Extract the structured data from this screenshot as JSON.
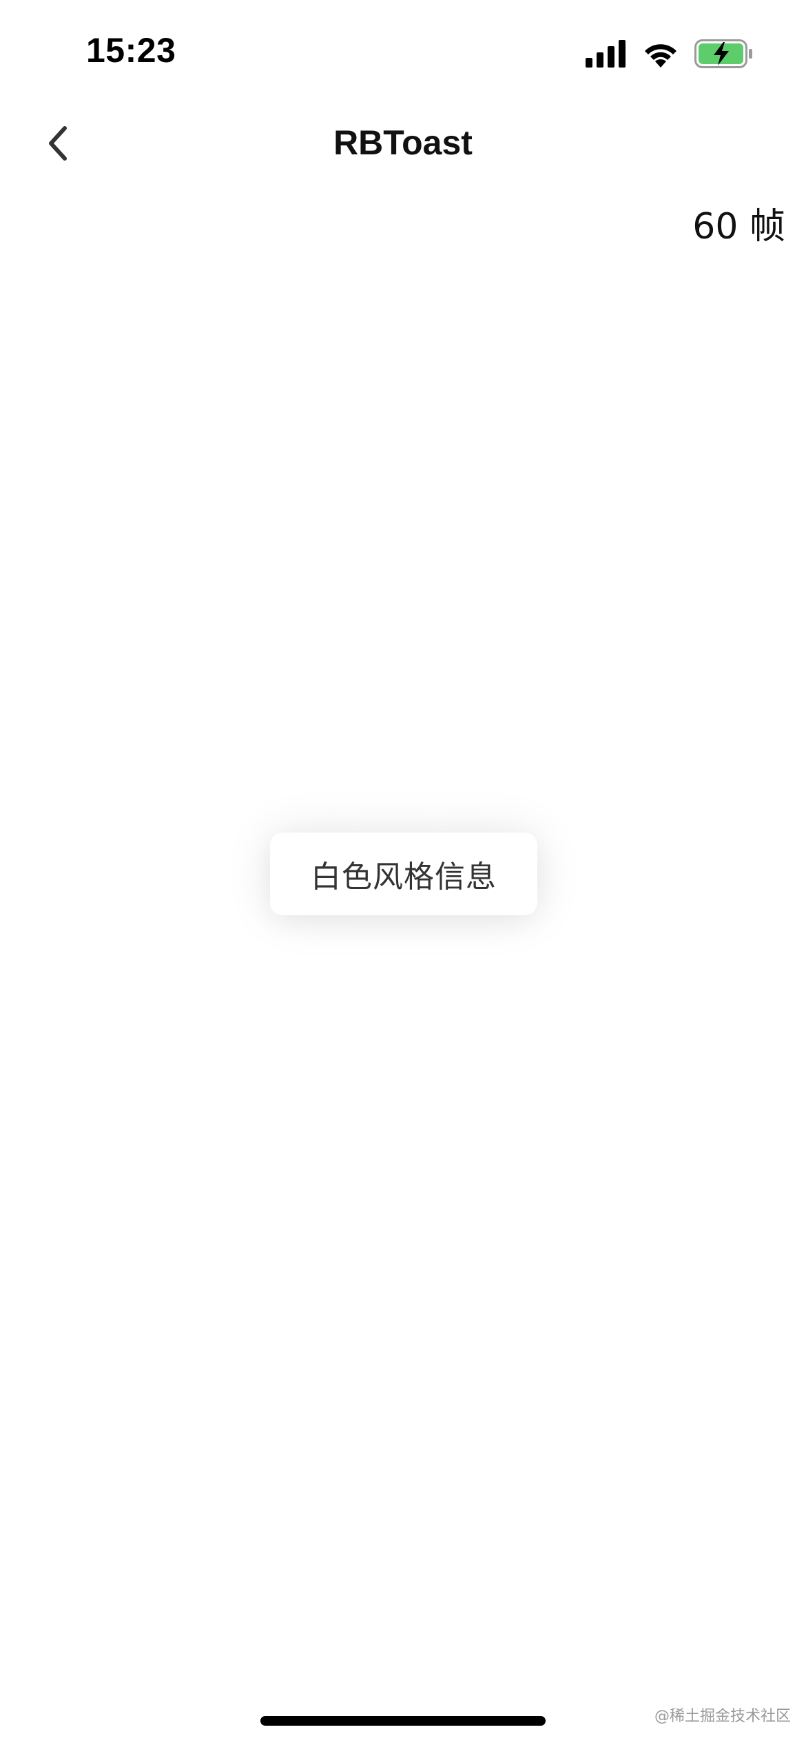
{
  "status_bar": {
    "time": "15:23",
    "icons": [
      "cellular-signal-icon",
      "wifi-icon",
      "battery-charging-icon"
    ],
    "battery_color": "#5dcc6a"
  },
  "nav": {
    "back_icon": "chevron-left-icon",
    "title": "RBToast"
  },
  "fps": {
    "label": "60 帧"
  },
  "toast": {
    "message": "白色风格信息"
  },
  "watermark": {
    "text": "@稀土掘金技术社区"
  }
}
